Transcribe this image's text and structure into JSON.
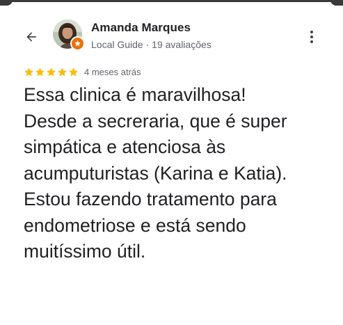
{
  "reviewer": {
    "name": "Amanda Marques",
    "meta": "Local Guide · 19 avaliações"
  },
  "review": {
    "rating": 5,
    "max_rating": 5,
    "time_ago": "4 meses atrás",
    "text": "Essa clinica é maravilhosa!\nDesde a secreraria, que é super\nsimpática e atenciosa às\nacumputuristas (Karina e Katia).\nEstou fazendo tratamento para\nendometriose e está sendo\nmuitíssimo útil."
  },
  "icons": {
    "back": "arrow-back-icon",
    "more": "more-vertical-icon",
    "badge": "local-guide-badge-icon",
    "star": "star-icon"
  },
  "colors": {
    "star": "#fbbc04",
    "badge": "#e8710a",
    "text_primary": "#202124",
    "text_secondary": "#5f6368"
  }
}
